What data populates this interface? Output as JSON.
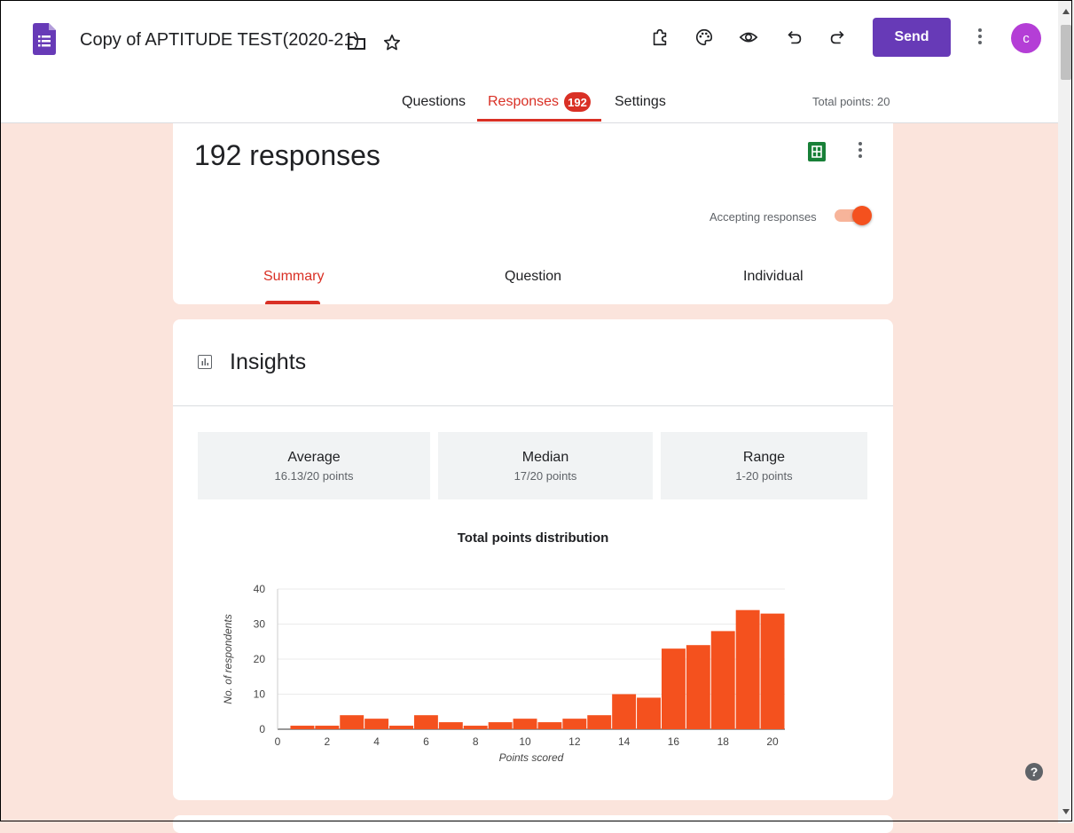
{
  "header": {
    "doc_title": "Copy of APTITUDE TEST(2020-21)",
    "send_label": "Send",
    "avatar_letter": "c",
    "tabs": [
      {
        "label": "Questions"
      },
      {
        "label": "Responses"
      },
      {
        "label": "Settings"
      }
    ],
    "responses_badge": "192",
    "total_points": "Total points: 20",
    "accent_color": "#673ab7"
  },
  "responses": {
    "title": "192 responses",
    "accepting_label": "Accepting responses",
    "accepting_on": true,
    "subtabs": [
      {
        "label": "Summary"
      },
      {
        "label": "Question"
      },
      {
        "label": "Individual"
      }
    ]
  },
  "insights": {
    "title": "Insights",
    "stats": [
      {
        "label": "Average",
        "value": "16.13/20 points"
      },
      {
        "label": "Median",
        "value": "17/20 points"
      },
      {
        "label": "Range",
        "value": "1-20 points"
      }
    ]
  },
  "chart_data": {
    "type": "bar",
    "title": "Total points distribution",
    "xlabel": "Points scored",
    "ylabel": "No. of respondents",
    "x": [
      1,
      2,
      3,
      4,
      5,
      6,
      7,
      8,
      9,
      10,
      11,
      12,
      13,
      14,
      15,
      16,
      17,
      18,
      19,
      20
    ],
    "values": [
      1,
      1,
      4,
      3,
      1,
      4,
      2,
      1,
      2,
      3,
      2,
      3,
      4,
      10,
      9,
      23,
      24,
      28,
      34,
      33
    ],
    "xlim": [
      0,
      20.5
    ],
    "ylim": [
      0,
      40
    ],
    "xticks": [
      0,
      2,
      4,
      6,
      8,
      10,
      12,
      14,
      16,
      18,
      20
    ],
    "yticks": [
      0,
      10,
      20,
      30,
      40
    ],
    "bar_color": "#f4511e",
    "grid": true
  }
}
